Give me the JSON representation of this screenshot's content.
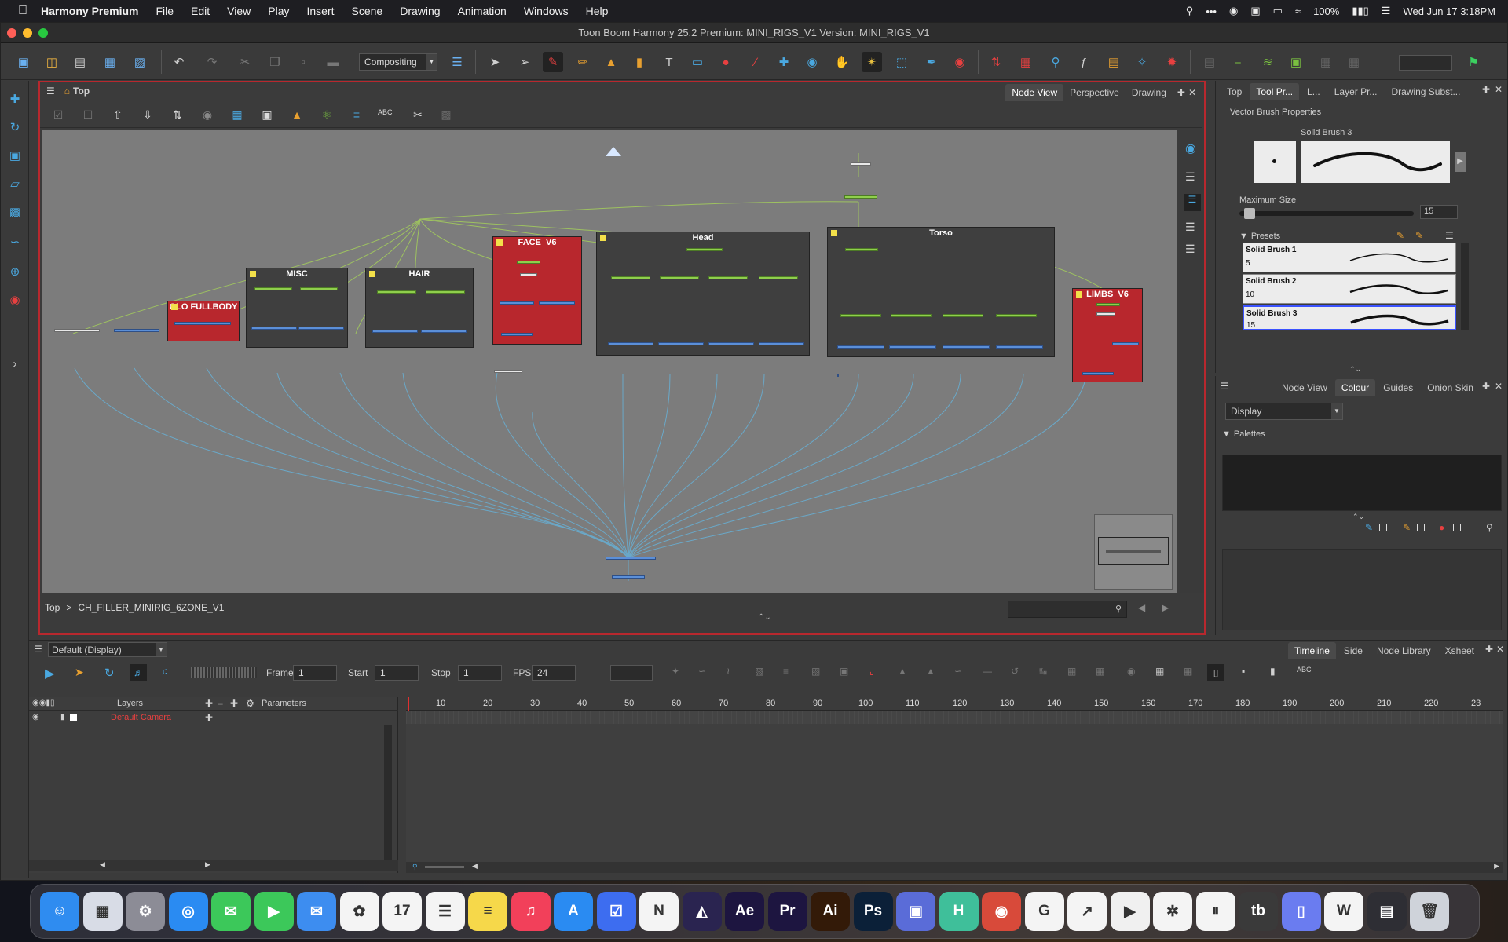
{
  "menubar": {
    "app": "Harmony Premium",
    "items": [
      "File",
      "Edit",
      "View",
      "Play",
      "Insert",
      "Scene",
      "Drawing",
      "Animation",
      "Windows",
      "Help"
    ],
    "battery": "100%",
    "datetime": "Wed Jun 17  3:18PM"
  },
  "window": {
    "title": "Toon Boom Harmony 25.2 Premium: MINI_RIGS_V1 Version: MINI_RIGS_V1"
  },
  "toolbar": {
    "workspace": "Compositing"
  },
  "node_view": {
    "top_label": "Top",
    "tabs": [
      "Node View",
      "Perspective",
      "Drawing"
    ],
    "groups": {
      "fullbody": "OLO FULLBODY",
      "misc": "MISC",
      "hair": "HAIR",
      "face": "FACE_V6",
      "head": "Head",
      "torso": "Torso",
      "limbs": "LIMBS_V6"
    },
    "breadcrumb": {
      "root": "Top",
      "separator": ">",
      "current": "CH_FILLER_MINIRIG_6ZONE_V1"
    }
  },
  "tool_panel": {
    "tabs": [
      "Top",
      "Tool Pr...",
      "L...",
      "Layer Pr...",
      "Drawing Subst..."
    ],
    "title": "Vector Brush Properties",
    "brush_name": "Solid Brush 3",
    "max_size_label": "Maximum Size",
    "max_size_value": "15",
    "presets_label": "Presets",
    "presets": [
      {
        "name": "Solid Brush 1",
        "size": "5"
      },
      {
        "name": "Solid Brush 2",
        "size": "10"
      },
      {
        "name": "Solid Brush 3",
        "size": "15"
      }
    ]
  },
  "colour_panel": {
    "tabs": [
      "Node View",
      "Colour",
      "Guides",
      "Onion Skin"
    ],
    "display": "Display",
    "palettes_label": "Palettes"
  },
  "timeline": {
    "display_select": "Default (Display)",
    "tabs": [
      "Timeline",
      "Side",
      "Node Library",
      "Xsheet"
    ],
    "frame_label": "Frame",
    "frame": "1",
    "start_label": "Start",
    "start": "1",
    "stop_label": "Stop",
    "stop": "1",
    "fps_label": "FPS",
    "fps": "24",
    "layers_label": "Layers",
    "parameters_label": "Parameters",
    "layer_placeholder": "Default Camera",
    "ruler": [
      "10",
      "20",
      "30",
      "40",
      "50",
      "60",
      "70",
      "80",
      "90",
      "100",
      "110",
      "120",
      "130",
      "140",
      "150",
      "160",
      "170",
      "180",
      "190",
      "200",
      "210",
      "220",
      "23"
    ]
  },
  "dock": {
    "apps": [
      {
        "name": "Finder",
        "glyph": "☺",
        "color": "#2f8cf0"
      },
      {
        "name": "Launchpad",
        "glyph": "▦",
        "color": "#d8dce6"
      },
      {
        "name": "System Settings",
        "glyph": "⚙",
        "color": "#8c8c96"
      },
      {
        "name": "Safari",
        "glyph": "◎",
        "color": "#2a8bf2"
      },
      {
        "name": "Messages",
        "glyph": "✉",
        "color": "#3cc85a"
      },
      {
        "name": "FaceTime",
        "glyph": "▶",
        "color": "#3cc85a"
      },
      {
        "name": "Mail",
        "glyph": "✉",
        "color": "#3d8df0"
      },
      {
        "name": "Photos",
        "glyph": "✿",
        "color": "#f4f4f4"
      },
      {
        "name": "Calendar",
        "glyph": "17",
        "color": "#f4f4f4"
      },
      {
        "name": "Reminders",
        "glyph": "☰",
        "color": "#f4f4f4"
      },
      {
        "name": "Notes",
        "glyph": "≡",
        "color": "#f6d84a"
      },
      {
        "name": "Music",
        "glyph": "♫",
        "color": "#f2405a"
      },
      {
        "name": "App Store",
        "glyph": "A",
        "color": "#2a8bf2"
      },
      {
        "name": "Things",
        "glyph": "☑",
        "color": "#3d6df0"
      },
      {
        "name": "Notion",
        "glyph": "N",
        "color": "#f4f4f4"
      },
      {
        "name": "Affinity",
        "glyph": "◭",
        "color": "#2a2450"
      },
      {
        "name": "After Effects",
        "glyph": "Ae",
        "color": "#1d1540"
      },
      {
        "name": "Premiere Pro",
        "glyph": "Pr",
        "color": "#1d1540"
      },
      {
        "name": "Illustrator",
        "glyph": "Ai",
        "color": "#331a08"
      },
      {
        "name": "Photoshop",
        "glyph": "Ps",
        "color": "#0b2038"
      },
      {
        "name": "Preview",
        "glyph": "▣",
        "color": "#5a6cd8"
      },
      {
        "name": "Harmony",
        "glyph": "H",
        "color": "#3fbf9a"
      },
      {
        "name": "Scrivener",
        "glyph": "◉",
        "color": "#d84a3a"
      },
      {
        "name": "Google Chrome",
        "glyph": "G",
        "color": "#f4f4f4"
      },
      {
        "name": "Stocks",
        "glyph": "↗",
        "color": "#f4f4f4"
      },
      {
        "name": "YouTube",
        "glyph": "▶",
        "color": "#f0f0f0"
      },
      {
        "name": "Perplexity",
        "glyph": "✲",
        "color": "#f4f4f4"
      },
      {
        "name": "Pause",
        "glyph": "⏸",
        "color": "#f4f4f4"
      },
      {
        "name": "Tour Box Console",
        "glyph": "tb",
        "color": "#3a3a3a"
      },
      {
        "name": "iPhone Mirroring",
        "glyph": "▯",
        "color": "#6a7cf0"
      },
      {
        "name": "Word",
        "glyph": "W",
        "color": "#f4f4f4"
      },
      {
        "name": "Stage Manager",
        "glyph": "▤",
        "color": "#2e2e34"
      },
      {
        "name": "Trash",
        "glyph": "🗑",
        "color": "#cfd3da"
      }
    ]
  },
  "colors": {
    "accent_red": "#b8282e",
    "node_green": "#8fcf4c",
    "node_blue": "#5b8fd8",
    "cable_green": "#a4c86a",
    "cable_blue": "#6aa8c8"
  }
}
